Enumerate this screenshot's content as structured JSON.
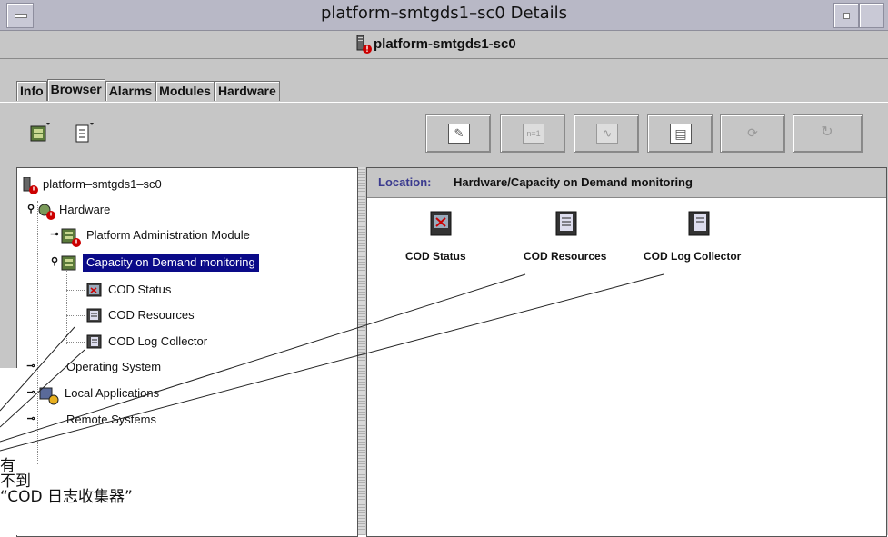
{
  "window": {
    "title": "platform–smtgds1–sc0 Details",
    "subtitle": "platform-smtgds1-sc0"
  },
  "tabs": [
    "Info",
    "Browser",
    "Alarms",
    "Modules",
    "Hardware"
  ],
  "toolbar_right": [
    {
      "name": "edit",
      "glyph": "✎"
    },
    {
      "name": "n1",
      "glyph": "n=1"
    },
    {
      "name": "graph",
      "glyph": "∿"
    },
    {
      "name": "table",
      "glyph": "▤"
    },
    {
      "name": "refresh-detail",
      "glyph": "⟳"
    },
    {
      "name": "refresh",
      "glyph": "↻"
    }
  ],
  "location": {
    "label": "Location:",
    "path": "Hardware/Capacity on Demand monitoring"
  },
  "tree": {
    "root": "platform–smtgds1–sc0",
    "hardware": "Hardware",
    "pam": "Platform Administration Module",
    "cod": "Capacity on Demand monitoring",
    "cod_status": "COD Status",
    "cod_resources": "COD Resources",
    "cod_log": "COD Log Collector",
    "os": "Operating System",
    "local_apps": "Local Applications",
    "remote": "Remote Systems"
  },
  "icons": {
    "status": "COD Status",
    "resources": "COD Resources",
    "log": "COD Log Collector"
  },
  "callout": [
    "有",
    "不到",
    "“COD 日志收集器”"
  ],
  "colors": {
    "selection": "#0a0a88",
    "alarm": "#cc0000",
    "location_label": "#3b3b8f"
  }
}
